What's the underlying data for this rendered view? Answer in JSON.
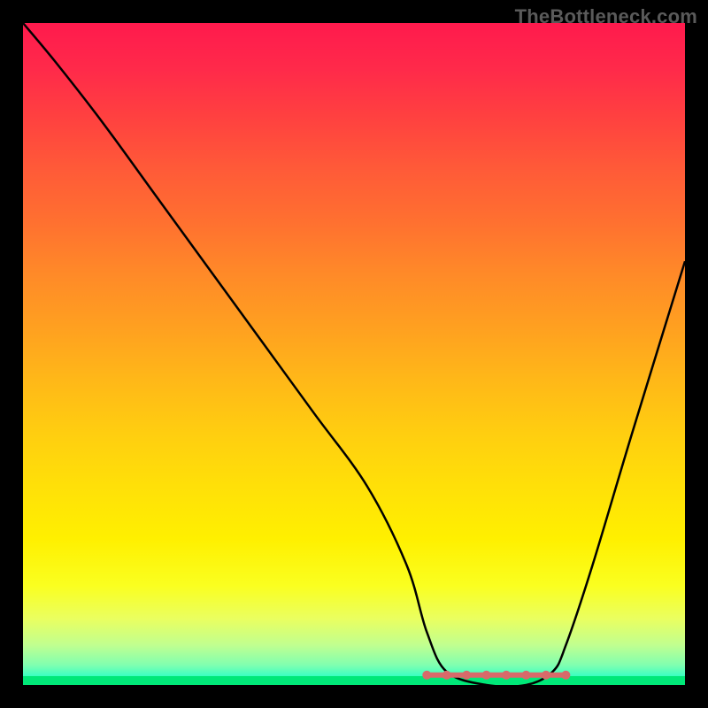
{
  "watermark": "TheBottleneck.com",
  "chart_data": {
    "type": "line",
    "title": "",
    "xlabel": "",
    "ylabel": "",
    "xlim": [
      0,
      100
    ],
    "ylim": [
      0,
      100
    ],
    "series": [
      {
        "name": "bottleneck-curve",
        "x": [
          0,
          5,
          12,
          20,
          28,
          36,
          44,
          52,
          58,
          61,
          64,
          70,
          76,
          80,
          82,
          86,
          92,
          100
        ],
        "y": [
          100,
          94,
          85,
          74,
          63,
          52,
          41,
          30,
          18,
          8,
          2,
          0,
          0,
          2,
          6,
          18,
          38,
          64
        ]
      }
    ],
    "flat_region": {
      "x_start": 61,
      "x_end": 82,
      "y": 1.5,
      "markers": [
        61,
        64,
        67,
        70,
        73,
        76,
        79,
        82
      ]
    },
    "gradient_stops": [
      {
        "pct": 0,
        "color": "#ff1a4d"
      },
      {
        "pct": 30,
        "color": "#ff7030"
      },
      {
        "pct": 62,
        "color": "#ffce10"
      },
      {
        "pct": 90,
        "color": "#eaff60"
      },
      {
        "pct": 100,
        "color": "#00ff90"
      }
    ]
  }
}
